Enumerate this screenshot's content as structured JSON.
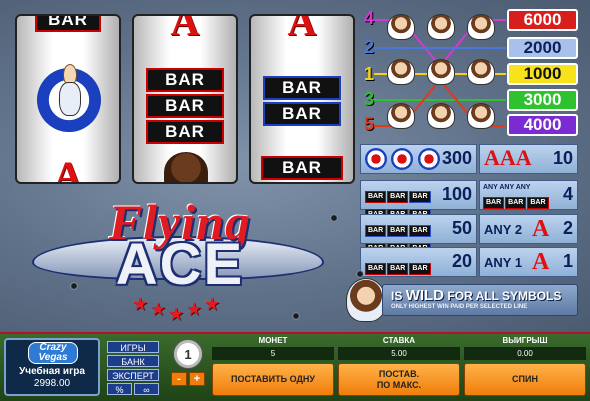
{
  "paylines": [
    {
      "number": "4",
      "color": "#d23bd2",
      "payout": "6000",
      "box_bg": "#d81d1d",
      "box_fg": "#ffffff"
    },
    {
      "number": "2",
      "color": "#4a78d8",
      "payout": "2000",
      "box_bg": "#a9c1ea",
      "box_fg": "#0b1f5a"
    },
    {
      "number": "1",
      "color": "#f2d21c",
      "payout": "1000",
      "box_bg": "#f7e21c",
      "box_fg": "#111111"
    },
    {
      "number": "3",
      "color": "#2ec22e",
      "payout": "3000",
      "box_bg": "#2ec22e",
      "box_fg": "#ffffff"
    },
    {
      "number": "5",
      "color": "#e13a1a",
      "payout": "4000",
      "box_bg": "#7a2bd2",
      "box_fg": "#ffffff"
    }
  ],
  "reels": {
    "bar_label": "BAR"
  },
  "paytable": {
    "left": [
      {
        "payout": "300"
      },
      {
        "payout": "100"
      },
      {
        "payout": "50"
      },
      {
        "payout": "20"
      }
    ],
    "right": [
      {
        "payout": "10"
      },
      {
        "payout": "4",
        "any_label": "ANY"
      },
      {
        "payout": "2",
        "any_label": "ANY 2"
      },
      {
        "payout": "1",
        "any_label": "ANY 1"
      }
    ]
  },
  "logo": {
    "line1": "Flying",
    "line2": "ACE"
  },
  "wild": {
    "prefix": "IS",
    "wild_word": "WILD",
    "suffix": "FOR ALL SYMBOLS",
    "footnote": "ONLY HIGHEST WIN PAID PER SELECTED LINE"
  },
  "controls": {
    "brand_line1": "Crazy",
    "brand_line2": "Vegas",
    "balance_label": "Учебная игра",
    "balance_value": "2998.00",
    "menu": {
      "games": "ИГРЫ",
      "bank": "БАНК",
      "expert": "ЭКСПЕРТ",
      "percent": "%",
      "glasses": "∞"
    },
    "coin_value": "1",
    "minus": "-",
    "plus": "+",
    "coins_label": "МОНЕТ",
    "coins_value": "5",
    "bet_label": "СТАВКА",
    "bet_value": "5.00",
    "win_label": "ВЫИГРЫШ",
    "win_value": "0.00",
    "bet_one": "ПОСТАВИТЬ ОДНУ",
    "bet_max_1": "ПОСТАВ.",
    "bet_max_2": "ПО МАКС.",
    "spin": "СПИН"
  }
}
